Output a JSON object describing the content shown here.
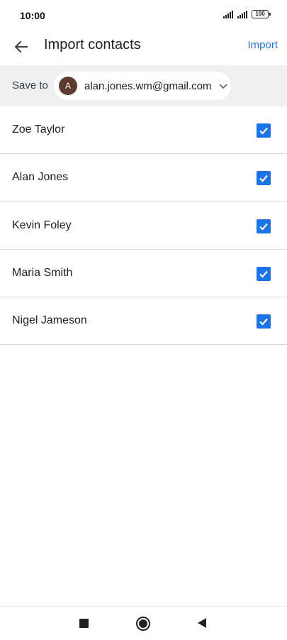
{
  "status_bar": {
    "time": "10:00",
    "battery": "100"
  },
  "app_bar": {
    "title": "Import contacts",
    "action_label": "Import"
  },
  "save_to": {
    "label": "Save to",
    "avatar_initial": "A",
    "account_email": "alan.jones.wm@gmail.com",
    "avatar_color": "#5d3a30"
  },
  "contacts": [
    {
      "name": "Zoe Taylor",
      "checked": true
    },
    {
      "name": "Alan Jones",
      "checked": true
    },
    {
      "name": "Kevin Foley",
      "checked": true
    },
    {
      "name": "Maria Smith",
      "checked": true
    },
    {
      "name": "Nigel Jameson",
      "checked": true
    }
  ],
  "colors": {
    "accent": "#1a73e8",
    "save_bar_bg": "#eeeff1",
    "divider": "#dadce0"
  },
  "icons": {
    "back": "arrow-left-icon",
    "dropdown": "chevron-down-icon",
    "checkbox": "checkbox-checked-icon",
    "nav_recents": "square-icon",
    "nav_home": "circle-icon",
    "nav_back": "triangle-back-icon"
  }
}
